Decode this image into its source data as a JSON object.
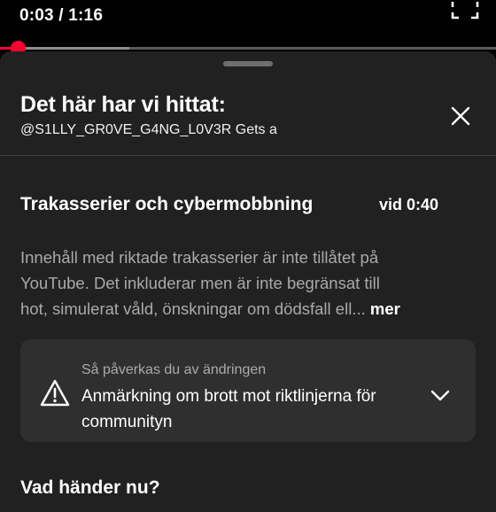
{
  "player": {
    "time_display": "0:03 / 1:16",
    "progress_fraction": 0.036,
    "buffered_fraction": 0.26
  },
  "sheet": {
    "title": "Det här har vi hittat:",
    "subtitle": "@S1LLY_GR0VE_G4NG_L0V3R Gets a"
  },
  "policy": {
    "title": "Trakasserier och cybermobbning",
    "timestamp": "vid 0:40",
    "description_lines": [
      "Innehåll med riktade trakasserier är inte tillåtet på",
      "YouTube. Det inkluderar men är inte begränsat till",
      "hot, simulerat våld, önskningar om dödsfall ell..."
    ],
    "more_label": "mer"
  },
  "impact_card": {
    "caption": "Så påverkas du av ändringen",
    "label": "Anmärkning om brott mot riktlinjerna för communityn"
  },
  "next": {
    "heading": "Vad händer nu?"
  },
  "colors": {
    "progress": "#ff0033",
    "sheet_background": "#212121",
    "card_background": "#2f2f2f",
    "muted_text": "#aaaaaa"
  },
  "icons": [
    "fullscreen-icon",
    "close-icon",
    "warning-icon",
    "chevron-down-icon"
  ]
}
